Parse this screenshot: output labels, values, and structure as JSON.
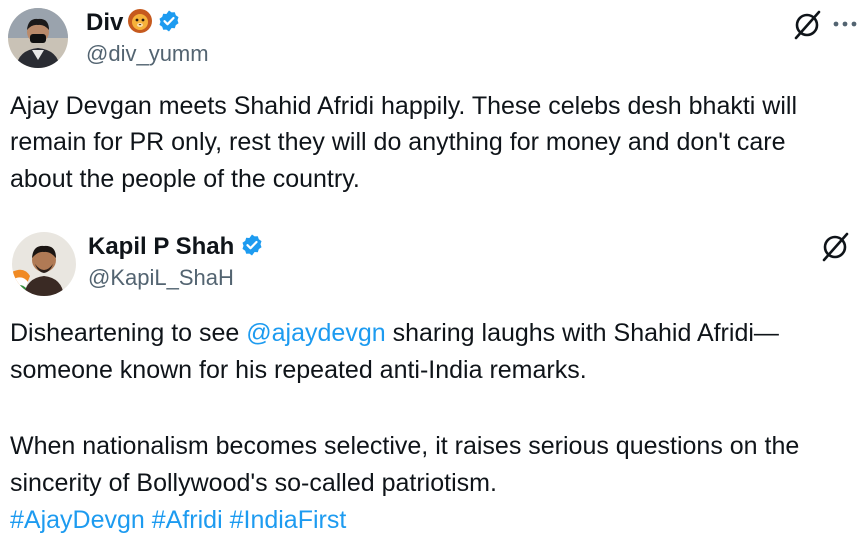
{
  "main_post": {
    "author_name": "Div",
    "author_handle": "@div_yumm",
    "text_lines": [
      "Ajay Devgan meets Shahid Afridi happily. These celebs desh bhakti will",
      "remain for PR only, rest they will do anything for money and don't care",
      "about the people of the country."
    ]
  },
  "quoted_post": {
    "author_name": "Kapil P Shah",
    "author_handle": "@KapiL_ShaH",
    "line1_before": "Disheartening to see ",
    "line1_mention": "@ajaydevgn",
    "line1_after": " sharing laughs with Shahid Afridi—",
    "line2": "someone known for his repeated anti-India remarks.",
    "line3": "When nationalism becomes selective, it raises serious questions on the",
    "line4": "sincerity of Bollywood's so-called patriotism.",
    "hashtags": [
      "#AjayDevgn",
      "#Afridi",
      "#IndiaFirst"
    ]
  },
  "icons": {
    "verified": "verified-badge-icon",
    "grok": "grok-icon",
    "more": "more-icon",
    "lion": "lion-emoji-icon"
  },
  "colors": {
    "text": "#0f1419",
    "secondary": "#536471",
    "link": "#1d9bf0",
    "verified": "#1d9bf0"
  }
}
